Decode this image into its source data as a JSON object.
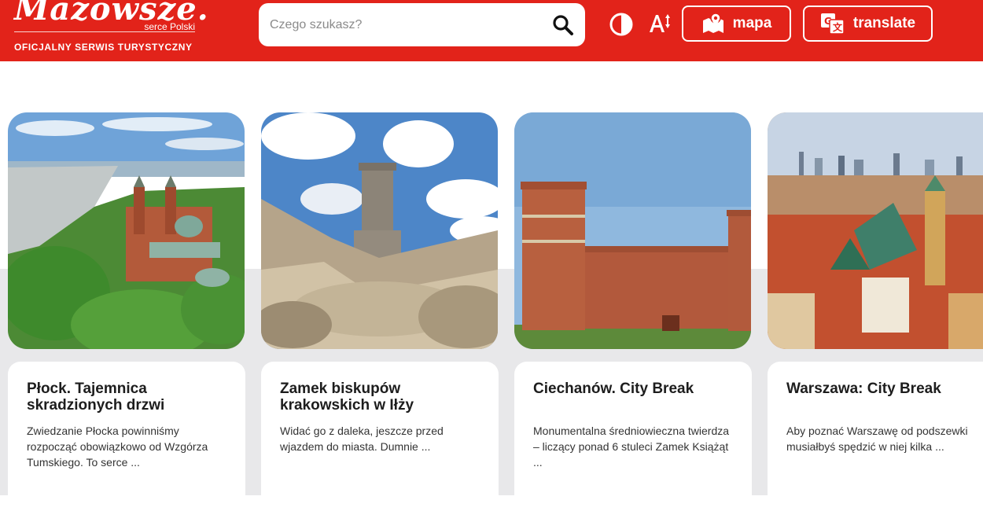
{
  "header": {
    "logo": {
      "word": "Mazowsze.",
      "sub": "serce Polski",
      "tagline": "OFICJALNY SERWIS TURYSTYCZNY"
    },
    "search": {
      "placeholder": "Czego szukasz?",
      "value": ""
    },
    "buttons": {
      "map_label": "mapa",
      "translate_label": "translate"
    },
    "icons": [
      "search-icon",
      "contrast-icon",
      "font-size-icon",
      "map-icon",
      "translate-icon"
    ],
    "colors": {
      "brand_red": "#e2231a",
      "white": "#ffffff"
    }
  },
  "cards": [
    {
      "title": "Płock. Tajemnica skradzionych drzwi",
      "text": "Zwiedzanie Płocka powinniśmy rozpocząć obowiązkowo od Wzgórza Tumskiego. To serce ...",
      "image": "plock-cathedral-aerial"
    },
    {
      "title": "Zamek biskupów krakowskich w Iłży",
      "text": "Widać go z daleka, jeszcze przed wjazdem do miasta. Dumnie ...",
      "image": "ilza-castle-tower"
    },
    {
      "title": "Ciechanów. City Break",
      "text": "Monumentalna średniowieczna twierdza – liczący ponad 6 stuleci Zamek Książąt ...",
      "image": "ciechanow-castle"
    },
    {
      "title": "Warszawa: City Break",
      "text": "Aby poznać Warszawę od podszewki musiałbyś spędzić w niej kilka ...",
      "image": "warsaw-old-town-aerial"
    }
  ]
}
